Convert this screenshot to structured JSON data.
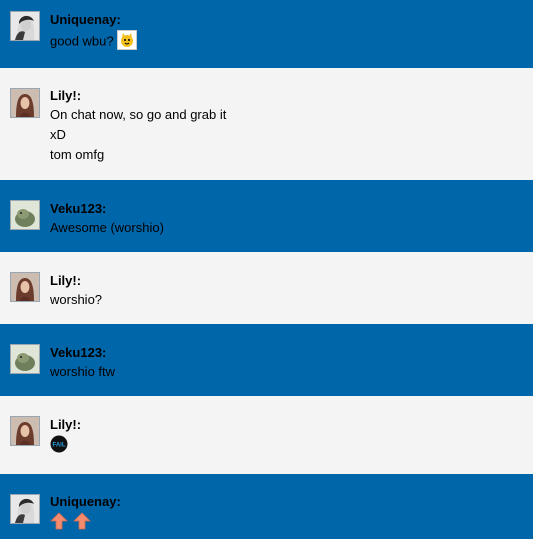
{
  "messages": [
    {
      "author": "Uniquenay:",
      "lines": [
        "good wbu? "
      ],
      "emoji": "smiley-cat-icon"
    },
    {
      "author": "Lily!:",
      "lines": [
        "On chat now, so go and grab it",
        "xD",
        "tom omfg"
      ]
    },
    {
      "author": "Veku123:",
      "lines": [
        "Awesome (worshio)"
      ]
    },
    {
      "author": "Lily!:",
      "lines": [
        "worshio?"
      ]
    },
    {
      "author": "Veku123:",
      "lines": [
        "worshio ftw"
      ]
    },
    {
      "author": "Lily!:",
      "lines": [],
      "emoji": "fail-badge-icon",
      "emoji_text": "FAIL"
    },
    {
      "author": "Uniquenay:",
      "lines": [],
      "emoji": "up-arrows-icon"
    }
  ],
  "colors": {
    "blue": "#0066aa",
    "grey": "#f4f4f4"
  }
}
